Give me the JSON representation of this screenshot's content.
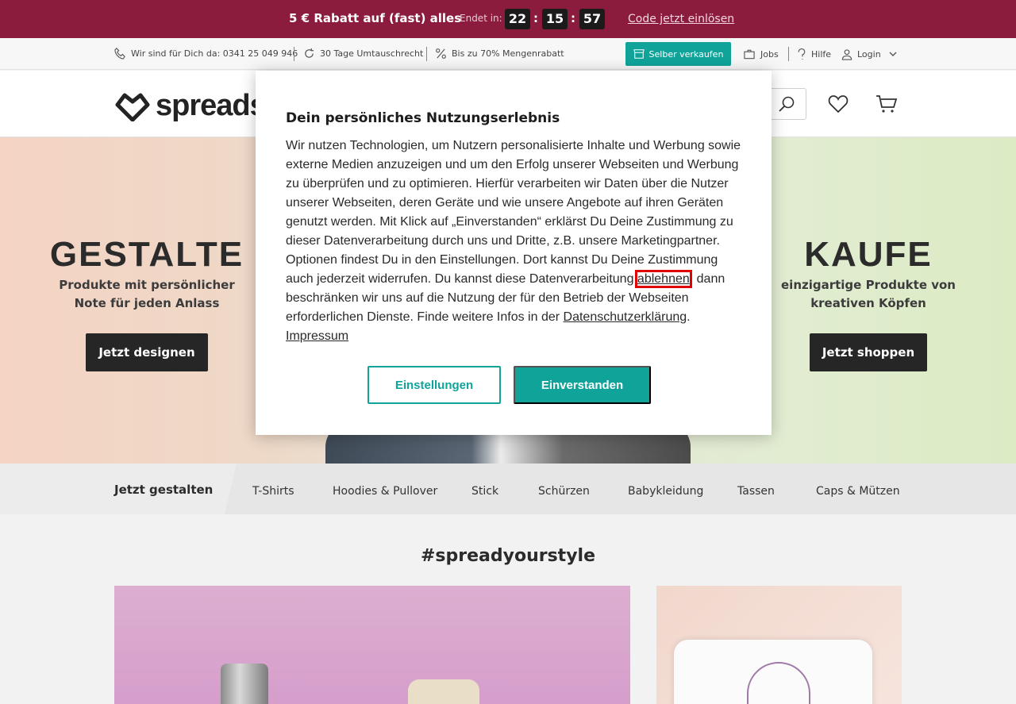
{
  "promo": {
    "title": "5 € Rabatt auf (fast) alles",
    "ends_label": "Endet in:",
    "hours": "22",
    "minutes": "15",
    "seconds": "57",
    "colon": ":",
    "link": "Code jetzt einlösen"
  },
  "service": {
    "phone": "Wir sind für Dich da: 0341 25 049 946",
    "exchange": "30 Tage Umtauschrecht",
    "discount": "Bis zu 70% Mengenrabatt",
    "sell_button": "Selber verkaufen",
    "jobs": "Jobs",
    "help": "Hilfe",
    "login": "Login"
  },
  "header": {
    "logo_text": "spreads"
  },
  "hero": {
    "left": {
      "heading": "GESTALTE",
      "sub_line1": "Produkte mit persönlicher",
      "sub_line2": "Note für jeden Anlass",
      "button": "Jetzt designen"
    },
    "right": {
      "heading": "KAUFE",
      "sub_line1": "einzigartige Produkte von",
      "sub_line2": "kreativen Köpfen",
      "button": "Jetzt shoppen"
    }
  },
  "categories": {
    "primary": "Jetzt gestalten",
    "items": [
      "T-Shirts",
      "Hoodies & Pullover",
      "Stick",
      "Schürzen",
      "Babykleidung",
      "Tassen",
      "Caps & Mützen"
    ]
  },
  "content": {
    "title": "#spreadyourstyle"
  },
  "consent": {
    "title": "Dein persönliches Nutzungserlebnis",
    "text_part1": "Wir nutzen Technologien, um Nutzern personalisierte Inhalte und Werbung sowie externe Medien anzuzeigen und um den Erfolg unserer Webseiten und Werbung zu überprüfen und zu optimieren. Hierfür verarbeiten wir Daten über die Nutzer unserer Webseiten, deren Geräte und wie unsere Angebote auf ihren Geräten genutzt werden. Mit Klick auf „Einverstanden“ erklärst Du Deine Zustimmung zu dieser Datenverarbeitung durch uns und Dritte, z.B. unsere Marketingpartner. Optionen findest Du in den Einstellungen. Dort kannst Du Deine Zustimmung auch jederzeit widerrufen. Du kannst diese Datenverarbeitung ",
    "reject_link": "ablehnen",
    "text_part2": ", dann beschränken wir uns auf die Nutzung der für den Betrieb der Webseiten erforderlichen Dienste. Finde weitere Infos in der ",
    "privacy_link": "Datenschutzerklärung",
    "text_part3": ". ",
    "imprint_link": "Impressum",
    "settings_button": "Einstellungen",
    "agree_button": "Einverstanden"
  },
  "colors": {
    "promo_bg": "#8c1c3e",
    "accent": "#0fa39a",
    "highlight": "#e00000"
  }
}
